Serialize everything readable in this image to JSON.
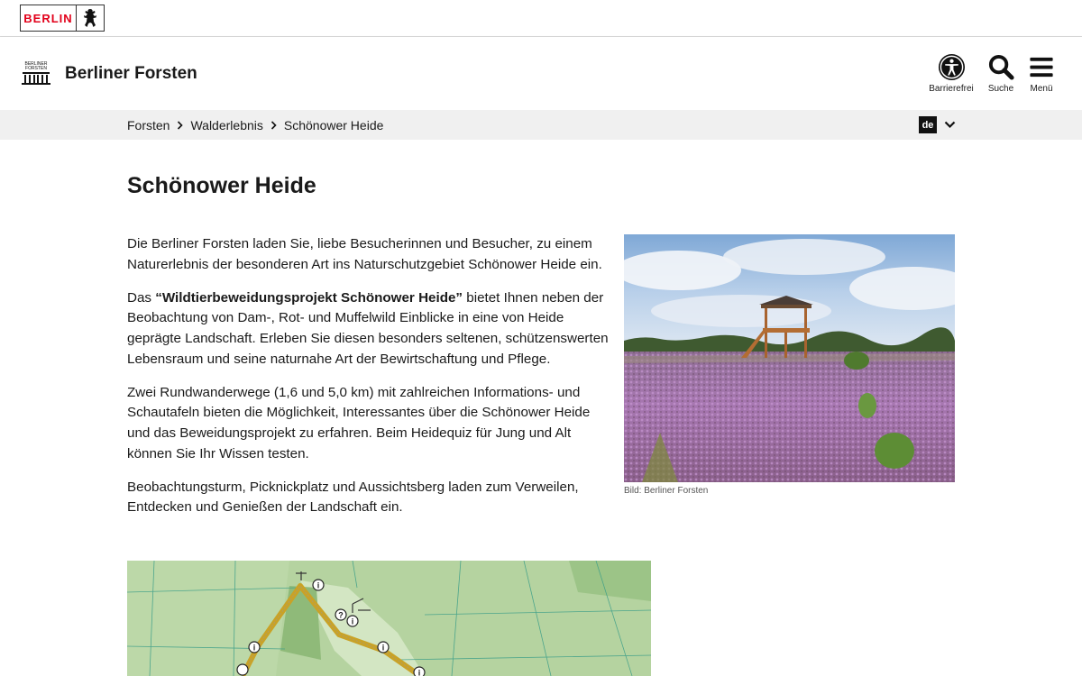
{
  "topbar": {
    "logo_text": "BERLIN"
  },
  "header": {
    "site_title": "Berliner Forsten",
    "emblem_text": "BERLINER FORSTEN",
    "a11y_label": "Barrierefrei",
    "search_label": "Suche",
    "menu_label": "Menü"
  },
  "breadcrumb": {
    "items": [
      "Forsten",
      "Walderlebnis",
      "Schönower Heide"
    ]
  },
  "language": {
    "current": "de"
  },
  "main": {
    "title": "Schönower Heide",
    "p1": "Die Berliner Forsten laden Sie, liebe Besucherinnen und Besucher, zu einem Naturerlebnis der besonderen Art ins Naturschutzgebiet Schönower Heide ein.",
    "p2_prefix": "Das ",
    "p2_bold": "“Wildtierbeweidungsprojekt Schönower Heide”",
    "p2_suffix": " bietet Ihnen neben der Beobachtung von Dam-, Rot- und Muffelwild Einblicke in eine von Heide geprägte Landschaft. Erleben Sie diesen besonders seltenen, schützenswerten Lebensraum und seine naturnahe Art der Bewirtschaftung und Pflege.",
    "p3": "Zwei Rundwanderwege (1,6 und 5,0 km) mit zahlreichen Informations- und Schautafeln bieten die Möglichkeit, Interessantes über die Schönower Heide und das Beweidungsprojekt zu erfahren. Beim Heidequiz für Jung und Alt können Sie Ihr Wissen testen.",
    "p4": "Beobachtungsturm, Picknickplatz und Aussichtsberg laden zum Verweilen, Entdecken und Genießen der Landschaft ein.",
    "image_caption": "Bild: Berliner Forsten"
  },
  "map": {
    "marker_info": "i",
    "marker_quiz": "?"
  },
  "colors": {
    "berlin_red": "#e2001a",
    "trail": "#c9a227",
    "map_green": "#b5d3a0"
  }
}
